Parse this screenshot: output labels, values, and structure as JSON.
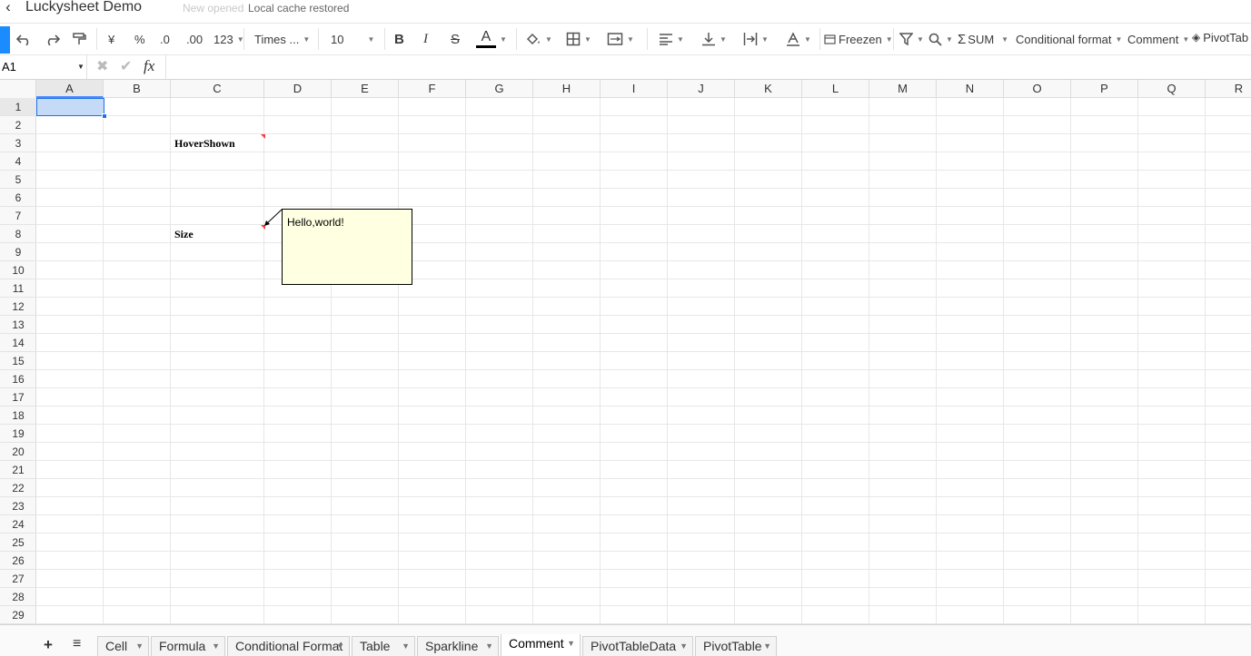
{
  "app": {
    "title": "Luckysheet Demo",
    "status_muted": "New opened",
    "status": "Local cache restored"
  },
  "toolbar": {
    "currency": "¥",
    "percent": "%",
    "dec_decrease": ".0",
    "dec_increase": ".00",
    "number_format": "123",
    "font_family": "Times ...",
    "font_size": "10",
    "bold": "B",
    "italic": "I",
    "strike": "S",
    "text_color_glyph": "A",
    "text_color": "#000000",
    "freeze": "Freezen",
    "sum": "SUM",
    "conditional_format": "Conditional format",
    "comment": "Comment",
    "pivot": "PivotTab"
  },
  "formula_bar": {
    "cell_ref": "A1",
    "cancel": "✖",
    "confirm": "✔",
    "fx": "fx",
    "value": ""
  },
  "columns": [
    "A",
    "B",
    "C",
    "D",
    "E",
    "F",
    "G",
    "H",
    "I",
    "J",
    "K",
    "L",
    "M",
    "N",
    "O",
    "P",
    "Q",
    "R"
  ],
  "rows": [
    "1",
    "2",
    "3",
    "4",
    "5",
    "6",
    "7",
    "8",
    "9",
    "10",
    "11",
    "12",
    "13",
    "14",
    "15",
    "16",
    "17",
    "18",
    "19",
    "20",
    "21",
    "22",
    "23",
    "24",
    "25",
    "26",
    "27",
    "28",
    "29"
  ],
  "cells": {
    "c3": "HoverShown",
    "c8": "Size"
  },
  "comment": {
    "text": "Hello,world!"
  },
  "sheets": {
    "add": "+",
    "menu": "≡",
    "tabs": [
      "Cell",
      "Formula",
      "Conditional Format",
      "Table",
      "Sparkline",
      "Comment",
      "PivotTableData",
      "PivotTable"
    ],
    "active": "Comment"
  },
  "colors": {
    "accent": "#1a73e8",
    "selection": "#c5daf6",
    "comment_bg": "#ffffe1",
    "comment_marker": "#ff3b3b"
  }
}
